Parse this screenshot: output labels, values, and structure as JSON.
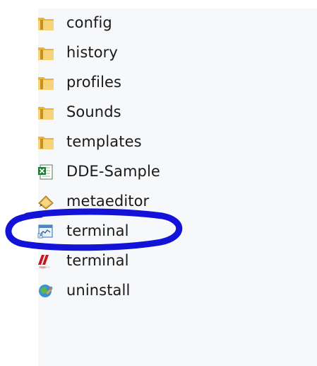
{
  "files": [
    {
      "name": "config",
      "icon": "folder-icon"
    },
    {
      "name": "history",
      "icon": "folder-icon"
    },
    {
      "name": "profiles",
      "icon": "folder-icon"
    },
    {
      "name": "Sounds",
      "icon": "folder-icon"
    },
    {
      "name": "templates",
      "icon": "folder-icon"
    },
    {
      "name": "DDE-Sample",
      "icon": "excel-icon"
    },
    {
      "name": "metaeditor",
      "icon": "metaeditor-icon"
    },
    {
      "name": "terminal",
      "icon": "terminal-window-icon"
    },
    {
      "name": "terminal",
      "icon": "terminal-app-icon"
    },
    {
      "name": "uninstall",
      "icon": "uninstall-icon"
    }
  ],
  "colors": {
    "highlight_circle": "#1212d8",
    "folder": "#e8b43c",
    "pane_background": "#f7f8fa"
  }
}
